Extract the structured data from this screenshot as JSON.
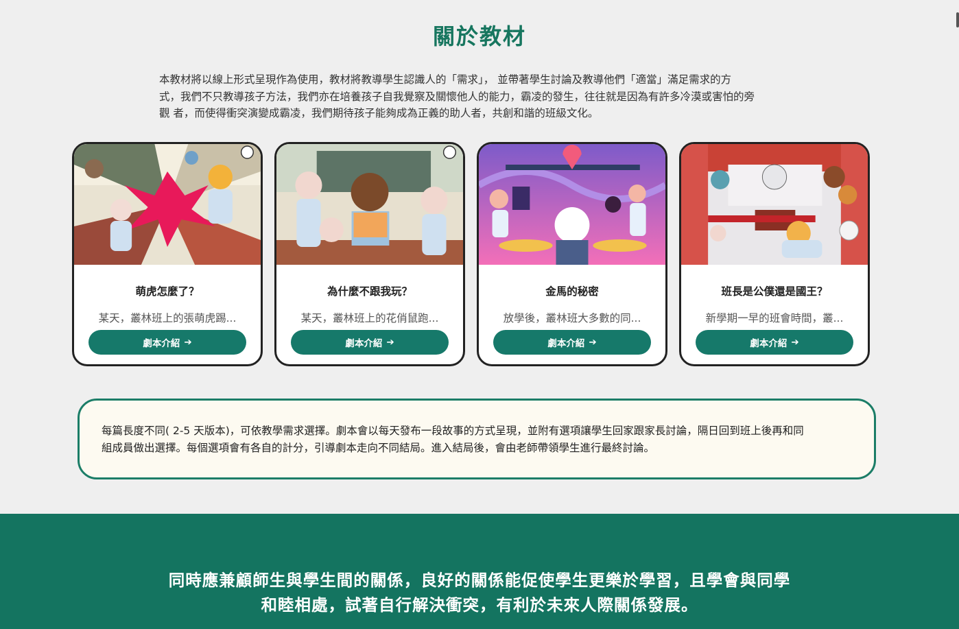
{
  "header": {
    "title": "關於教材"
  },
  "intro": {
    "lines": [
      "本教材將以線上形式呈現作為使用，教材將教導學生認識人的「需求」， 並帶著學生討論及教導他們「適當」滿足需求的方",
      "式，我們不只教導孩子方法，我們亦在培養孩子自我覺察及關懷他人的能力，霸凌的發生，往往就是因為有許多冷漠或害怕的旁",
      "觀 者，而使得衝突演變成霸凌，我們期待孩子能夠成為正義的助人者，共創和諧的班級文化。"
    ]
  },
  "cards": [
    {
      "title": "萌虎怎麼了？",
      "desc": "某天，叢林班上的張萌虎踢...",
      "button": "劇本介紹",
      "arrow": "➔"
    },
    {
      "title": "為什麼不跟我玩？",
      "desc": "某天，叢林班上的花俏鼠跑...",
      "button": "劇本介紹",
      "arrow": "➔"
    },
    {
      "title": "金馬的秘密",
      "desc": "放學後，叢林班大多數的同...",
      "button": "劇本介紹",
      "arrow": "➔"
    },
    {
      "title": "班長是公僕還是國王？",
      "desc": "新學期一早的班會時間，叢...",
      "button": "劇本介紹",
      "arrow": "➔"
    }
  ],
  "note": {
    "lines": [
      "每篇長度不同( 2-5 天版本)，可依教學需求選擇。劇本會以每天發布一段故事的方式呈現，並附有選項讓學生回家跟家長討論，隔日回到班上後再和同",
      "組成員做出選擇。每個選項會有各自的計分，引導劇本走向不同結局。進入結局後，會由老師帶領學生進行最終討論。"
    ]
  },
  "banner": {
    "lines": [
      "同時應兼顧師生與學生間的關係，良好的關係能促使學生更樂於學習，且學會與同學",
      "和睦相處，試著自行解決衝突，有利於未來人際關係發展。"
    ]
  },
  "colors": {
    "accent": "#17765f",
    "button": "#16796a",
    "band": "#147460",
    "note_bg": "#fdfaf1"
  }
}
